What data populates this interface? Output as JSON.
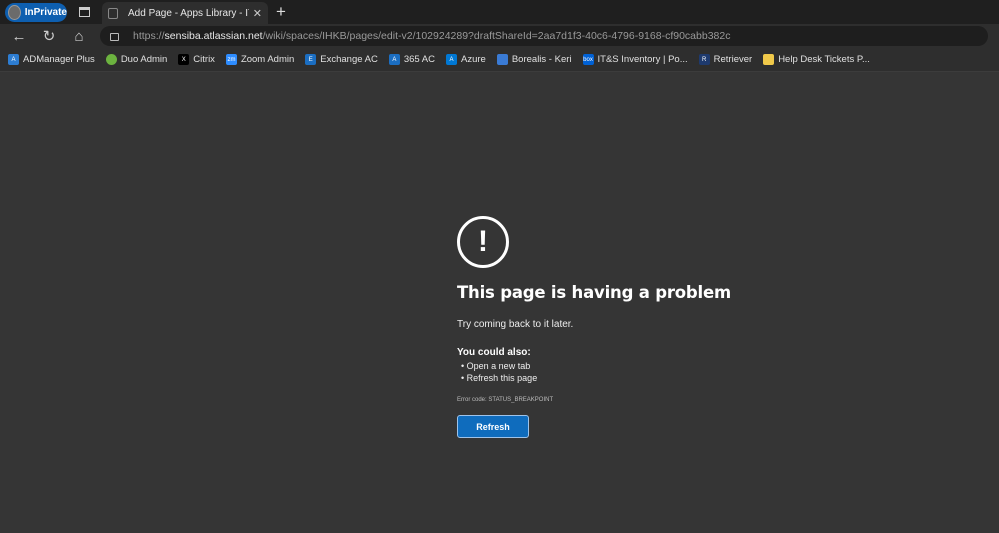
{
  "browser": {
    "inprivate_label": "InPrivate",
    "tab_title": "Add Page - Apps Library - IT Help",
    "url_scheme": "https://",
    "url_host": "sensiba.atlassian.net",
    "url_path": "/wiki/spaces/IHKB/pages/edit-v2/102924289?draftShareId=2aa7d1f3-40c6-4796-9168-cf90cabb382c",
    "bookmarks": [
      {
        "label": "ADManager Plus",
        "color": "#2d7dd2",
        "icon": "A"
      },
      {
        "label": "Duo Admin",
        "color": "#6cb33f",
        "icon": ""
      },
      {
        "label": "Citrix",
        "color": "#000000",
        "icon": "X"
      },
      {
        "label": "Zoom Admin",
        "color": "#2d8cff",
        "icon": "zm"
      },
      {
        "label": "Exchange AC",
        "color": "#1b6ec2",
        "icon": "E"
      },
      {
        "label": "365 AC",
        "color": "#1b6ec2",
        "icon": "A"
      },
      {
        "label": "Azure",
        "color": "#0078d4",
        "icon": "A"
      },
      {
        "label": "Borealis - Keri",
        "color": "#3a7bd5",
        "icon": ""
      },
      {
        "label": "IT&S Inventory | Po...",
        "color": "#0061d5",
        "icon": "box"
      },
      {
        "label": "Retriever",
        "color": "#1e3a6e",
        "icon": "R"
      },
      {
        "label": "Help Desk Tickets P...",
        "color": "#f0c94a",
        "icon": ""
      }
    ]
  },
  "error": {
    "title": "This page is having a problem",
    "subtitle": "Try coming back to it later.",
    "also_heading": "You could also:",
    "suggestions": [
      "Open a new tab",
      "Refresh this page"
    ],
    "error_code": "Error code: STATUS_BREAKPOINT",
    "refresh_label": "Refresh"
  }
}
